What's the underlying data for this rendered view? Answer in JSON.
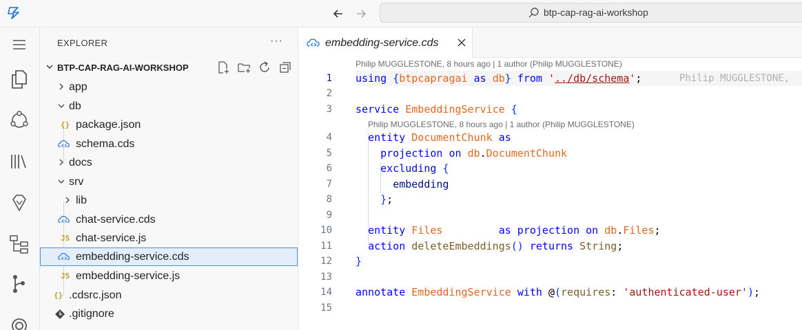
{
  "title_bar": {
    "search_text": "btp-cap-rag-ai-workshop"
  },
  "explorer": {
    "title": "EXPLORER",
    "more": "···",
    "workspace": "BTP-CAP-RAG-AI-WORKSHOP",
    "tree": [
      {
        "label": "app",
        "type": "folder",
        "expanded": false,
        "depth": 1
      },
      {
        "label": "db",
        "type": "folder",
        "expanded": true,
        "depth": 1
      },
      {
        "label": "package.json",
        "type": "json",
        "depth": 2
      },
      {
        "label": "schema.cds",
        "type": "cds",
        "depth": 2
      },
      {
        "label": "docs",
        "type": "folder",
        "expanded": false,
        "depth": 1
      },
      {
        "label": "srv",
        "type": "folder",
        "expanded": true,
        "depth": 1
      },
      {
        "label": "lib",
        "type": "folder",
        "expanded": false,
        "depth": 2
      },
      {
        "label": "chat-service.cds",
        "type": "cds",
        "depth": 2
      },
      {
        "label": "chat-service.js",
        "type": "js",
        "depth": 2
      },
      {
        "label": "embedding-service.cds",
        "type": "cds",
        "depth": 2,
        "selected": true
      },
      {
        "label": "embedding-service.js",
        "type": "js",
        "depth": 2
      },
      {
        "label": ".cdsrc.json",
        "type": "json",
        "depth": 1
      },
      {
        "label": ".gitignore",
        "type": "git",
        "depth": 1
      }
    ]
  },
  "editor": {
    "tab_label": "embedding-service.cds",
    "blame_top": "Philip MUGGLESTONE, 8 hours ago | 1 author (Philip MUGGLESTONE)",
    "blame_service": "Philip MUGGLESTONE, 8 hours ago | 1 author (Philip MUGGLESTONE)",
    "inline_blame": "Philip MUGGLESTONE,",
    "line_numbers": [
      "1",
      "2",
      "3",
      "4",
      "5",
      "6",
      "7",
      "8",
      "9",
      "10",
      "11",
      "12",
      "13",
      "14",
      "15"
    ],
    "code_lines": [
      "using {btpcapragai as db} from '../db/schema';",
      "",
      "service EmbeddingService {",
      "  entity DocumentChunk as",
      "    projection on db.DocumentChunk",
      "    excluding {",
      "      embedding",
      "    };",
      "",
      "  entity Files         as projection on db.Files;",
      "  action deleteEmbeddings() returns String;",
      "}",
      "",
      "annotate EmbeddingService with @(requires: 'authenticated-user');",
      ""
    ]
  }
}
